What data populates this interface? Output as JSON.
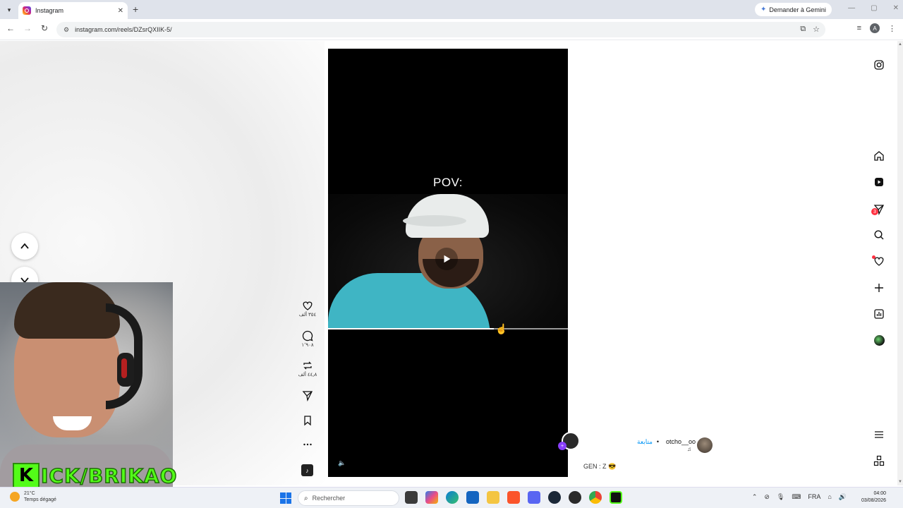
{
  "browser": {
    "tab_title": "Instagram",
    "url": "instagram.com/reels/DZsrQXIIK-5/",
    "gemini_label": "Demander à Gemini",
    "profile_initial": "A"
  },
  "reel": {
    "overlay_text": "POV:",
    "progress": 0.69,
    "likes": "٣٥٤ ألف",
    "comments": "١٬٩٠٨",
    "reposts": "٤٤٫٨ ألف"
  },
  "author": {
    "username": "otcho__oo",
    "separator": "•",
    "follow_label": "متابعة",
    "music_note": "♫",
    "caption": "GEN : Z 😎"
  },
  "nav": {
    "messages_badge": "3"
  },
  "overlay": {
    "kick_letter": "K",
    "kick_text": "ICK/BRIKAO"
  },
  "taskbar": {
    "weather_temp": "21°C",
    "weather_desc": "Temps dégagé",
    "search_placeholder": "Rechercher",
    "language": "FRA",
    "time": "04:00",
    "date": "03/08/2026"
  },
  "colors": {
    "instagram_blue": "#0095f6",
    "kick_green": "#53fc18",
    "badge_red": "#ff3040"
  }
}
